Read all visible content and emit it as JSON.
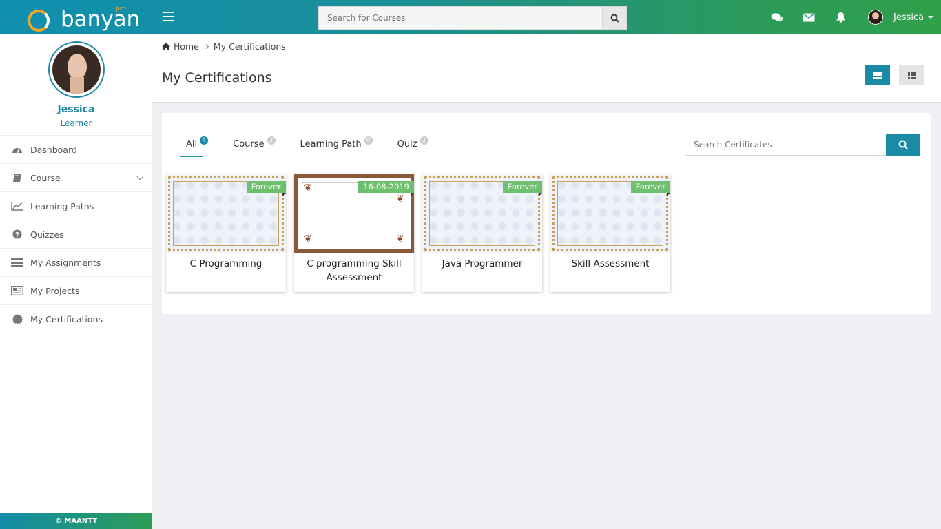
{
  "header": {
    "logo_text": "banyan",
    "logo_sup": "pro",
    "search_placeholder": "Search for Courses",
    "user_name": "Jessica"
  },
  "sidebar": {
    "profile": {
      "name": "Jessica",
      "role": "Learner"
    },
    "items": [
      {
        "label": "Dashboard",
        "icon": "dashboard-icon"
      },
      {
        "label": "Course",
        "icon": "book-icon"
      },
      {
        "label": "Learning Paths",
        "icon": "line-chart-icon"
      },
      {
        "label": "Quizzes",
        "icon": "question-icon"
      },
      {
        "label": "My Assignments",
        "icon": "assignments-icon"
      },
      {
        "label": "My Projects",
        "icon": "projects-icon"
      },
      {
        "label": "My Certifications",
        "icon": "certificate-icon"
      }
    ],
    "footer": "© MAANTT"
  },
  "breadcrumb": {
    "home": "Home",
    "current": "My Certifications"
  },
  "page": {
    "title": "My Certifications"
  },
  "tabs": [
    {
      "label": "All",
      "count": "4"
    },
    {
      "label": "Course",
      "count": "2"
    },
    {
      "label": "Learning Path",
      "count": "0"
    },
    {
      "label": "Quiz",
      "count": "2"
    }
  ],
  "cert_search": {
    "placeholder": "Search Certificates"
  },
  "certificates": [
    {
      "title": "C Programming",
      "validity": "Forever"
    },
    {
      "title": "C programming Skill Assessment",
      "validity": "16-08-2019"
    },
    {
      "title": "Java Programmer",
      "validity": "Forever"
    },
    {
      "title": "Skill Assessment",
      "validity": "Forever"
    }
  ],
  "colors": {
    "accent": "#1a8aa6",
    "ribbon": "#6fc06e",
    "header_start": "#0f8fb0",
    "header_end": "#30a04a"
  }
}
